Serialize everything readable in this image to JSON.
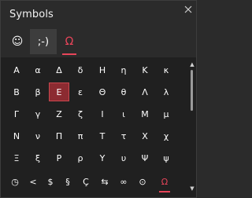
{
  "window": {
    "title": "Symbols",
    "close_icon": "close-icon"
  },
  "tabs": [
    {
      "label": "☺",
      "icon": "smiley-icon"
    },
    {
      "label": ";-)",
      "icon": "kaomoji"
    },
    {
      "label": "Ω",
      "icon": "omega-symbols"
    }
  ],
  "accent_color": "#e8455a",
  "highlight_color": "#8c2b31",
  "grid": {
    "rows": [
      [
        "Α",
        "α",
        "Δ",
        "δ",
        "Η",
        "η",
        "Κ",
        "κ"
      ],
      [
        "Β",
        "β",
        "Ε",
        "ε",
        "Θ",
        "θ",
        "Λ",
        "λ"
      ],
      [
        "Γ",
        "γ",
        "Ζ",
        "ζ",
        "Ι",
        "ι",
        "Μ",
        "μ"
      ],
      [
        "Ν",
        "ν",
        "Π",
        "π",
        "Τ",
        "τ",
        "Χ",
        "χ"
      ],
      [
        "Ξ",
        "ξ",
        "Ρ",
        "ρ",
        "Υ",
        "υ",
        "Ψ",
        "ψ"
      ]
    ],
    "highlighted": "Ε"
  },
  "bottom_bar": [
    {
      "label": "◷",
      "icon": "history-icon"
    },
    {
      "label": "<",
      "icon": "less-than"
    },
    {
      "label": "$",
      "icon": "currency"
    },
    {
      "label": "§",
      "icon": "section-sign"
    },
    {
      "label": "Ç",
      "icon": "latin-symbols"
    },
    {
      "label": "⇆",
      "icon": "arrows-icon"
    },
    {
      "label": "∞",
      "icon": "math-symbols"
    },
    {
      "label": "⊙",
      "icon": "circled-symbols"
    },
    {
      "label": "Ω",
      "icon": "greek-symbols"
    }
  ],
  "scroll": {
    "up": "▲",
    "down": "▼"
  }
}
